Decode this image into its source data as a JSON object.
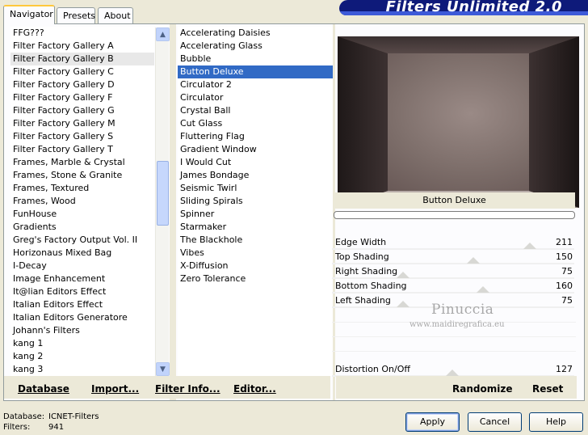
{
  "tabs": [
    "Navigator",
    "Presets",
    "About"
  ],
  "banner_title": "Filters Unlimited 2.0",
  "categories": [
    "FFG???",
    "Filter Factory Gallery A",
    "Filter Factory Gallery B",
    "Filter Factory Gallery C",
    "Filter Factory Gallery D",
    "Filter Factory Gallery F",
    "Filter Factory Gallery G",
    "Filter Factory Gallery M",
    "Filter Factory Gallery S",
    "Filter Factory Gallery T",
    "Frames, Marble & Crystal",
    "Frames, Stone & Granite",
    "Frames, Textured",
    "Frames, Wood",
    "FunHouse",
    "Gradients",
    "Greg's Factory Output Vol. II",
    "Horizonaus Mixed Bag",
    "I-Decay",
    "Image Enhancement",
    "It@lian Editors Effect",
    "Italian Editors Effect",
    "Italian Editors Generatore",
    "Johann's Filters",
    "kang 1",
    "kang 2",
    "kang 3"
  ],
  "selected_category": "Filter Factory Gallery B",
  "filters": [
    "Accelerating Daisies",
    "Accelerating Glass",
    "Bubble",
    "Button Deluxe",
    "Circulator 2",
    "Circulator",
    "Crystal Ball",
    "Cut Glass",
    "Fluttering Flag",
    "Gradient Window",
    "I Would Cut",
    "James Bondage",
    "Seismic Twirl",
    "Sliding Spirals",
    "Spinner",
    "Starmaker",
    "The Blackhole",
    "Vibes",
    "X-Diffusion",
    "Zero Tolerance"
  ],
  "selected_filter": "Button Deluxe",
  "filter_title": "Button Deluxe",
  "params": [
    {
      "label": "Edge Width",
      "value": "211",
      "level": 0.83
    },
    {
      "label": "Top Shading",
      "value": "150",
      "level": 0.59
    },
    {
      "label": "Right Shading",
      "value": "75",
      "level": 0.29
    },
    {
      "label": "Bottom Shading",
      "value": "160",
      "level": 0.63
    },
    {
      "label": "Left Shading",
      "value": "75",
      "level": 0.29
    }
  ],
  "distortion": {
    "label": "Distortion On/Off",
    "value": "127",
    "level": 0.5
  },
  "watermark": {
    "name": "Pinuccia",
    "url": "www.maidiregrafica.eu"
  },
  "bottom_buttons": {
    "database": "Database",
    "import": "Import...",
    "filter_info": "Filter Info...",
    "editor": "Editor...",
    "randomize": "Randomize",
    "reset": "Reset"
  },
  "status": {
    "database_label": "Database:",
    "database_value": "ICNET-Filters",
    "filters_label": "Filters:",
    "filters_value": "941"
  },
  "dialog_buttons": {
    "apply": "Apply",
    "cancel": "Cancel",
    "help": "Help"
  }
}
